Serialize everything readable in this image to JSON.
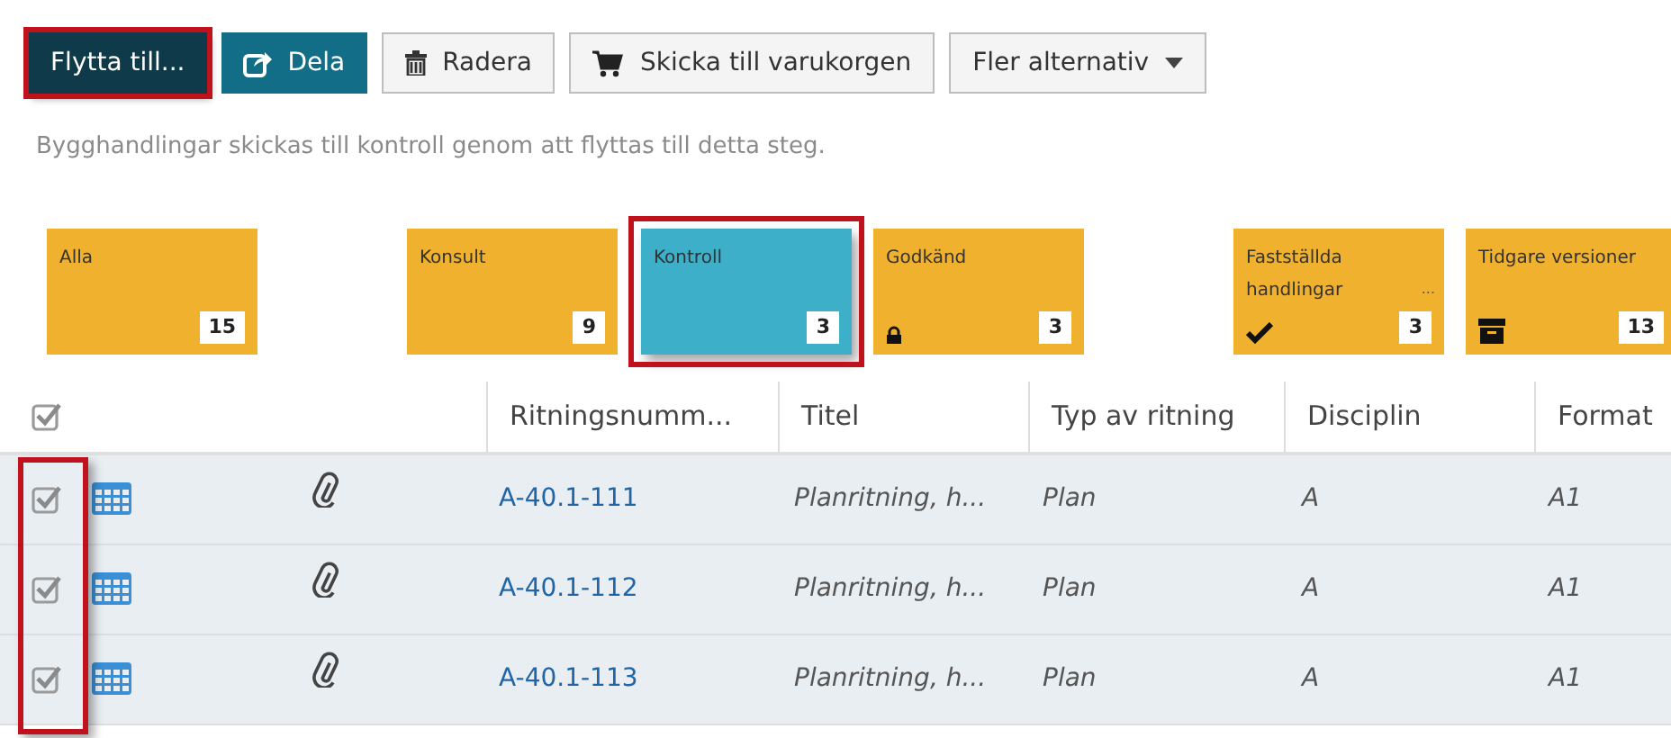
{
  "toolbar": [
    {
      "label": "Flytta till...",
      "kind": "primary",
      "highlighted": true
    },
    {
      "label": "Dela",
      "kind": "share",
      "highlighted": false
    },
    {
      "label": "Radera",
      "kind": "delete",
      "highlighted": false
    },
    {
      "label": "Skicka till varukorgen",
      "kind": "cart",
      "highlighted": false
    },
    {
      "label": "Fler alternativ",
      "kind": "dropdown",
      "highlighted": false
    }
  ],
  "hint": "Bygghandlingar skickas till kontroll genom att flyttas till detta steg.",
  "stages": [
    {
      "label": "Alla",
      "count": "15",
      "kind": "plain",
      "selected": false
    },
    {
      "label": "Konsult",
      "count": "9",
      "kind": "plain",
      "selected": false
    },
    {
      "label": "Kontroll",
      "count": "3",
      "kind": "plain",
      "selected": true
    },
    {
      "label": "Godkänd",
      "count": "3",
      "kind": "locked",
      "selected": false
    },
    {
      "label": "Fastställda handlingar",
      "count": "3",
      "kind": "approved",
      "selected": false,
      "more": "..."
    },
    {
      "label": "Tidgare versioner",
      "count": "13",
      "kind": "archived",
      "selected": false
    }
  ],
  "table": {
    "all_checked": true,
    "checkbox_column_highlighted": true,
    "columns": [
      "Ritningsnumm...",
      "Titel",
      "Typ av ritning",
      "Disciplin",
      "Format"
    ],
    "rows": [
      {
        "checked": true,
        "number": "A-40.1-111",
        "title": "Planritning, h...",
        "type": "Plan",
        "discipline": "A",
        "format": "A1"
      },
      {
        "checked": true,
        "number": "A-40.1-112",
        "title": "Planritning, h...",
        "type": "Plan",
        "discipline": "A",
        "format": "A1"
      },
      {
        "checked": true,
        "number": "A-40.1-113",
        "title": "Planritning, h...",
        "type": "Plan",
        "discipline": "A",
        "format": "A1"
      }
    ]
  }
}
